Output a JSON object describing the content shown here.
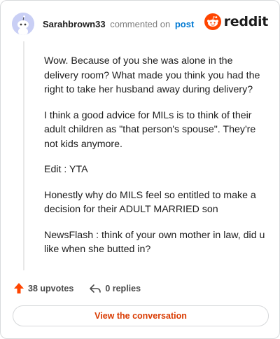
{
  "header": {
    "username": "Sarahbrown33",
    "commented_text": "commented on",
    "post_link": "post",
    "logo_text": "reddit",
    "avatar_icon": "snoo-avatar-icon",
    "logo_icon": "reddit-snoo-icon"
  },
  "comment": {
    "paragraphs": [
      "Wow. Because of you she was alone in the delivery room? What made you think you had the right to take her husband away during delivery?",
      "I think a good advice for MILs is to think of their adult children as \"that person's spouse\". They're not kids anymore.",
      "Edit : YTA",
      "Honestly why do MILS feel so entitled to make a decision for their ADULT MARRIED son",
      "NewsFlash : think of your own mother in law, did u like when she butted in?"
    ]
  },
  "actions": {
    "upvotes": "38 upvotes",
    "replies": "0 replies",
    "upvote_icon": "upvote-arrow-icon",
    "reply_icon": "reply-arrow-icon"
  },
  "cta": {
    "label": "View the conversation"
  },
  "colors": {
    "accent": "#ff4500",
    "link": "#0079d3",
    "cta_text": "#d93a00",
    "avatar_bg": "#c9cff5"
  }
}
